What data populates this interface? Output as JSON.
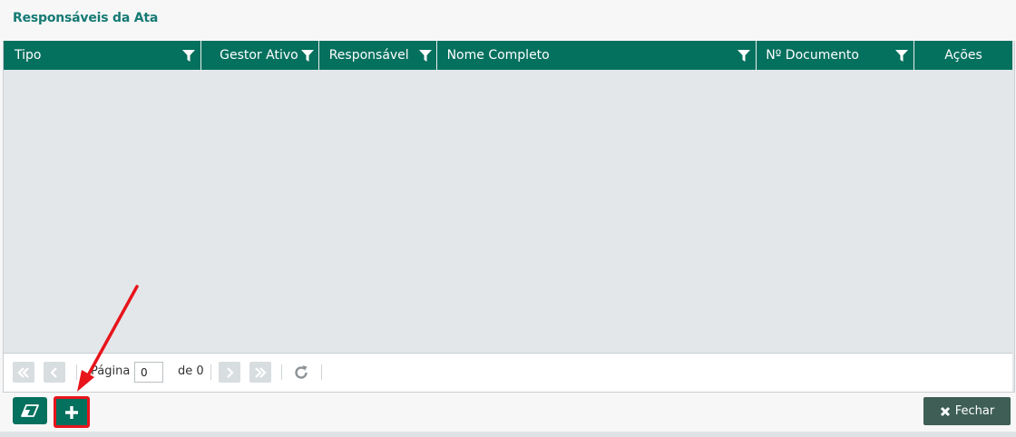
{
  "window": {
    "title": "Responsáveis da Ata"
  },
  "grid": {
    "columns": [
      {
        "label": "Tipo",
        "filterable": true
      },
      {
        "label": "Gestor Ativo",
        "filterable": true
      },
      {
        "label": "Responsável",
        "filterable": true
      },
      {
        "label": "Nome Completo",
        "filterable": true
      },
      {
        "label": "Nº Documento",
        "filterable": true
      },
      {
        "label": "Ações",
        "filterable": false
      }
    ],
    "rows": []
  },
  "pager": {
    "page_label": "Página",
    "page_value": "0",
    "of_label": "de 0",
    "first_icon": "double-chevron-left-icon",
    "prev_icon": "chevron-left-icon",
    "next_icon": "chevron-right-icon",
    "last_icon": "double-chevron-right-icon",
    "refresh_icon": "refresh-icon"
  },
  "footer": {
    "clear_icon": "eraser-icon",
    "add_icon": "plus-icon",
    "close_label": "Fechar",
    "close_icon": "x-icon"
  },
  "colors": {
    "header_bg": "#04705e",
    "title_color": "#167a74",
    "annotation": "#e8141b",
    "close_bg": "#3e5e56"
  }
}
